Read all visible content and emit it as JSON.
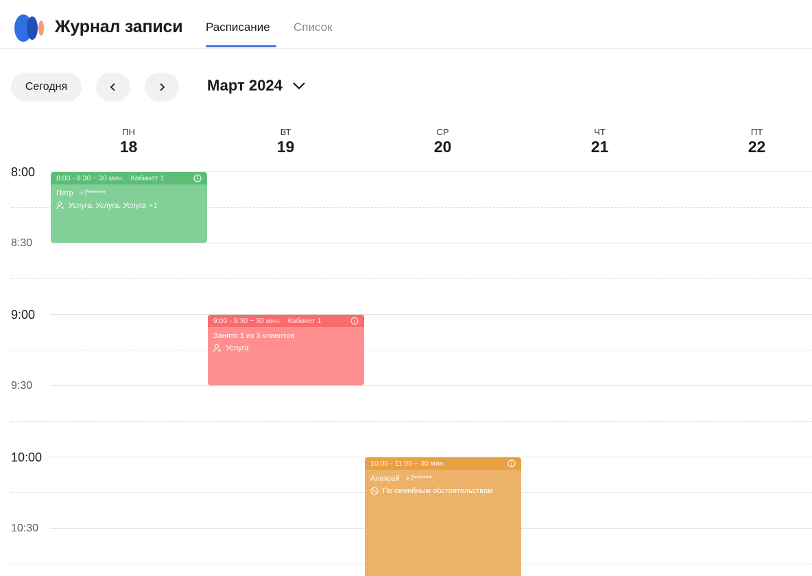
{
  "app": {
    "title": "Журнал записи",
    "brand_colors": [
      "#2f6fe0",
      "#1f4fb8",
      "#f39b7c"
    ]
  },
  "tabs": [
    {
      "label": "Расписание",
      "active": true
    },
    {
      "label": "Список",
      "active": false
    }
  ],
  "toolbar": {
    "today_label": "Сегодня",
    "prev_icon": "chevron-left-icon",
    "next_icon": "chevron-right-icon",
    "month_label": "Март 2024",
    "dropdown_icon": "chevron-down-icon"
  },
  "days": [
    {
      "name": "ПН",
      "number": "18"
    },
    {
      "name": "ВТ",
      "number": "19"
    },
    {
      "name": "СР",
      "number": "20"
    },
    {
      "name": "ЧТ",
      "number": "21"
    },
    {
      "name": "ПТ",
      "number": "22"
    }
  ],
  "times": [
    "8:00",
    "8:30",
    "9:00",
    "9:30",
    "10:00",
    "10:30"
  ],
  "events": [
    {
      "color": "#82cf98",
      "time": "8:00 - 8:30  ~ 30 мин.",
      "room": "Кабинет 1",
      "title": "Петр",
      "phone": "+7******",
      "services": "Услуга, Услуга, Услуга",
      "more": "+1"
    },
    {
      "color": "#ff8f8f",
      "time": "9:00 - 9:30  ~ 30 мин.",
      "room": "Кабинет 1",
      "title": "Занято 1 из 3 клиентов",
      "services": "Услуга"
    },
    {
      "color": "#ecb26a",
      "time": "10:00 - 11:00  ~ 30 мин.",
      "title": "Алексей",
      "phone": "+7******",
      "cancel_reason": "По семейным обстоятельствам"
    }
  ]
}
